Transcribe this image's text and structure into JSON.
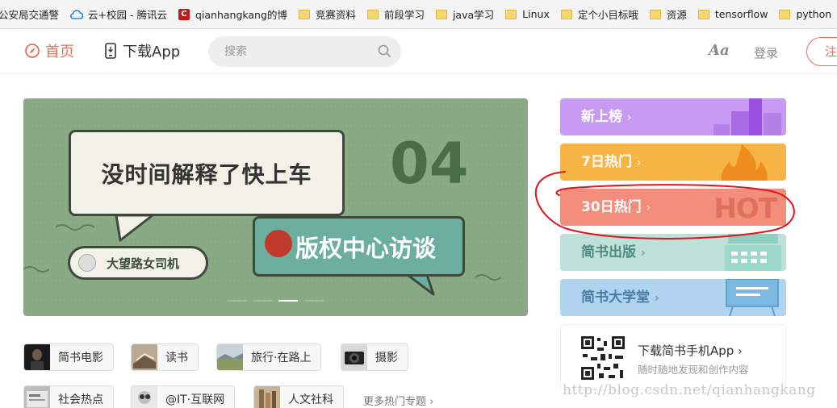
{
  "bookmarks": [
    {
      "label": "公安局交通警",
      "icon": "none"
    },
    {
      "label": "云+校园 - 腾讯云",
      "icon": "cloud-icon"
    },
    {
      "label": "qianhangkang的博",
      "icon": "csdn-icon"
    },
    {
      "label": "竞赛资料",
      "icon": "folder-icon"
    },
    {
      "label": "前段学习",
      "icon": "folder-icon"
    },
    {
      "label": "java学习",
      "icon": "folder-icon"
    },
    {
      "label": "Linux",
      "icon": "folder-icon"
    },
    {
      "label": "定个小目标哦",
      "icon": "folder-icon"
    },
    {
      "label": "资源",
      "icon": "folder-icon"
    },
    {
      "label": "tensorflow",
      "icon": "folder-icon"
    },
    {
      "label": "python",
      "icon": "folder-icon"
    }
  ],
  "nav": {
    "home": "首页",
    "app": "下载App",
    "search_placeholder": "搜索",
    "font_toggle": "Aa",
    "login": "登录",
    "signup": "注"
  },
  "banner": {
    "bubble_text": "没时间解释了快上车",
    "number": "04",
    "title": "版权中心访谈",
    "tag": "大望路女司机",
    "slides": 4,
    "active_slide": 3
  },
  "boards": [
    {
      "label": "新上榜",
      "color": "#c79bf2"
    },
    {
      "label": "7日热门",
      "color": "#f7b548"
    },
    {
      "label": "30日热门",
      "color": "#f48e7c",
      "deco": "HOT"
    },
    {
      "label": "简书出版",
      "color": "#bde0d8"
    },
    {
      "label": "简书大学堂",
      "color": "#b0d3ee"
    }
  ],
  "download": {
    "title": "下载简书手机App",
    "subtitle": "随时随地发现和创作内容"
  },
  "topics": [
    {
      "label": "简书电影"
    },
    {
      "label": "读书"
    },
    {
      "label": "旅行·在路上"
    },
    {
      "label": "摄影"
    },
    {
      "label": "社会热点"
    },
    {
      "label": "@IT·互联网"
    },
    {
      "label": "人文社科"
    }
  ],
  "more_topics": "更多热门专题 ›",
  "watermark": "http://blog.csdn.net/qianhangkang",
  "colors": {
    "accent": "#ea6f5a",
    "annotation": "#e0141b"
  }
}
